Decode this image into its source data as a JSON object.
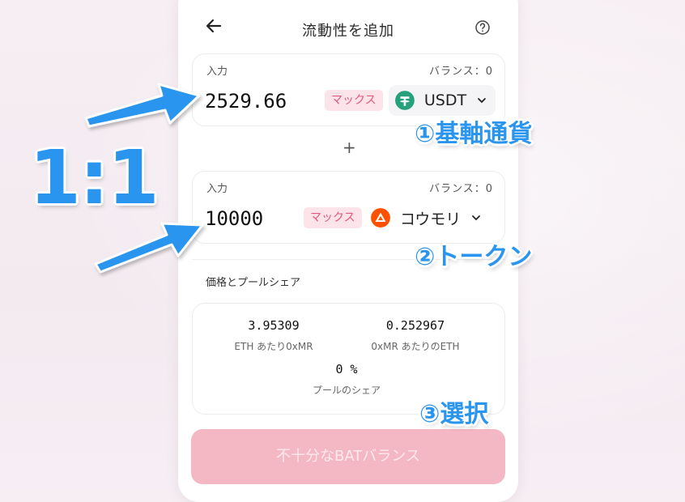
{
  "header": {
    "title": "流動性を追加"
  },
  "input_a": {
    "label": "入力",
    "balance": "バランス：0",
    "amount": "2529.66",
    "max_label": "マックス",
    "token": "USDT"
  },
  "input_b": {
    "label": "入力",
    "balance": "バランス：0",
    "amount": "10000",
    "max_label": "マックス",
    "token": "コウモリ"
  },
  "plus": "+",
  "price": {
    "title": "価格とプールシェア",
    "rate1_value": "3.95309",
    "rate1_caption": "ETH あたり0xMR",
    "rate2_value": "0.252967",
    "rate2_caption": "0xMR あたりのETH",
    "share_value": "0 %",
    "share_caption": "プールのシェア"
  },
  "submit_label": "不十分なBATバランス",
  "annotations": {
    "ratio": "1:1",
    "base": "①基軸通貨",
    "token": "②トークン",
    "select": "③選択"
  },
  "colors": {
    "accent_pink": "#e2587e",
    "button_disabled": "#f4b8c4",
    "annotation_blue": "#2a95ef",
    "usdt_green": "#26a17b",
    "bat_orange": "#ff5000"
  }
}
